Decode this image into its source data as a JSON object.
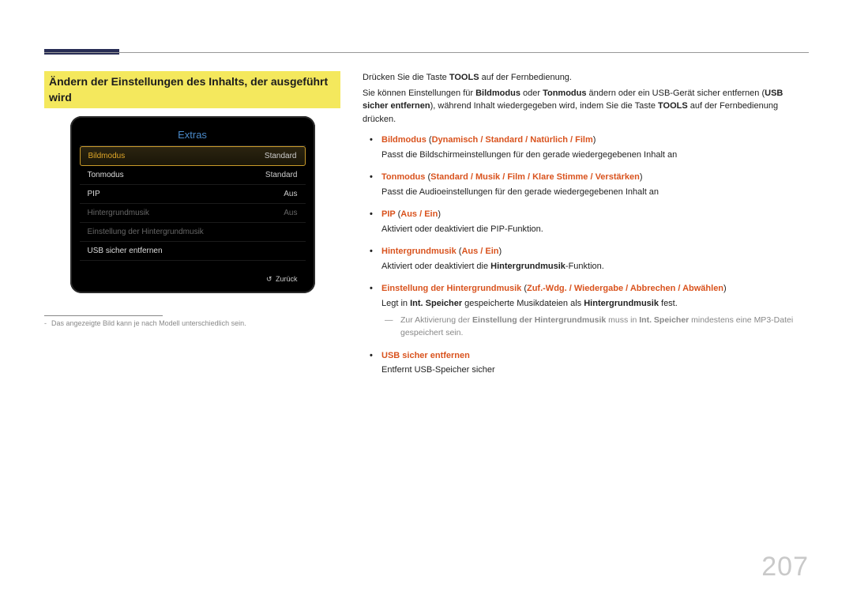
{
  "heading": "Ändern der Einstellungen des Inhalts, der ausgeführt wird",
  "panel": {
    "title": "Extras",
    "rows": [
      {
        "label": "Bildmodus",
        "value": "Standard",
        "state": "selected"
      },
      {
        "label": "Tonmodus",
        "value": "Standard",
        "state": ""
      },
      {
        "label": "PIP",
        "value": "Aus",
        "state": ""
      },
      {
        "label": "Hintergrundmusik",
        "value": "Aus",
        "state": "dim"
      },
      {
        "label": "Einstellung der Hintergrundmusik",
        "value": "",
        "state": "dim"
      },
      {
        "label": "USB sicher entfernen",
        "value": "",
        "state": ""
      }
    ],
    "back": "Zurück"
  },
  "left_footnote": "Das angezeigte Bild kann je nach Modell unterschiedlich sein.",
  "intro": {
    "l1a": "Drücken Sie die Taste ",
    "l1b": "TOOLS",
    "l1c": " auf der Fernbedienung.",
    "l2a": "Sie können Einstellungen für ",
    "l2b": "Bildmodus",
    "l2c": " oder ",
    "l2d": "Tonmodus",
    "l2e": " ändern oder ein USB-Gerät sicher entfernen (",
    "l2f": "USB sicher entfernen",
    "l2g": "), während Inhalt wiedergegeben wird, indem Sie die Taste ",
    "l2h": "TOOLS",
    "l2i": " auf der Fernbedienung drücken."
  },
  "opts": {
    "o1": {
      "name": "Bildmodus",
      "v": "Dynamisch / Standard / Natürlich / Film",
      "desc": "Passt die Bildschirmeinstellungen für den gerade wiedergegebenen Inhalt an"
    },
    "o2": {
      "name": "Tonmodus",
      "v": "Standard / Musik / Film / Klare Stimme / Verstärken",
      "desc": "Passt die Audioeinstellungen für den gerade wiedergegebenen Inhalt an"
    },
    "o3": {
      "name": "PIP",
      "v": "Aus / Ein",
      "desc": "Aktiviert oder deaktiviert die PIP-Funktion."
    },
    "o4": {
      "name": "Hintergrundmusik",
      "v": "Aus / Ein",
      "desc_a": "Aktiviert oder deaktiviert die ",
      "desc_b": "Hintergrundmusik",
      "desc_c": "-Funktion."
    },
    "o5": {
      "name": "Einstellung der Hintergrundmusik",
      "v": "Zuf.-Wdg. / Wiedergabe / Abbrechen / Abwählen",
      "desc_a": "Legt in ",
      "desc_b": "Int. Speicher",
      "desc_c": " gespeicherte Musikdateien als ",
      "desc_d": "Hintergrundmusik",
      "desc_e": " fest."
    },
    "o6": {
      "name": "USB sicher entfernen",
      "desc": "Entfernt USB-Speicher sicher"
    }
  },
  "subnote": {
    "a": "Zur Aktivierung der ",
    "b": "Einstellung der Hintergrundmusik",
    "c": " muss in ",
    "d": "Int. Speicher",
    "e": " mindestens eine MP3-Datei gespeichert sein."
  },
  "pagenum": "207"
}
